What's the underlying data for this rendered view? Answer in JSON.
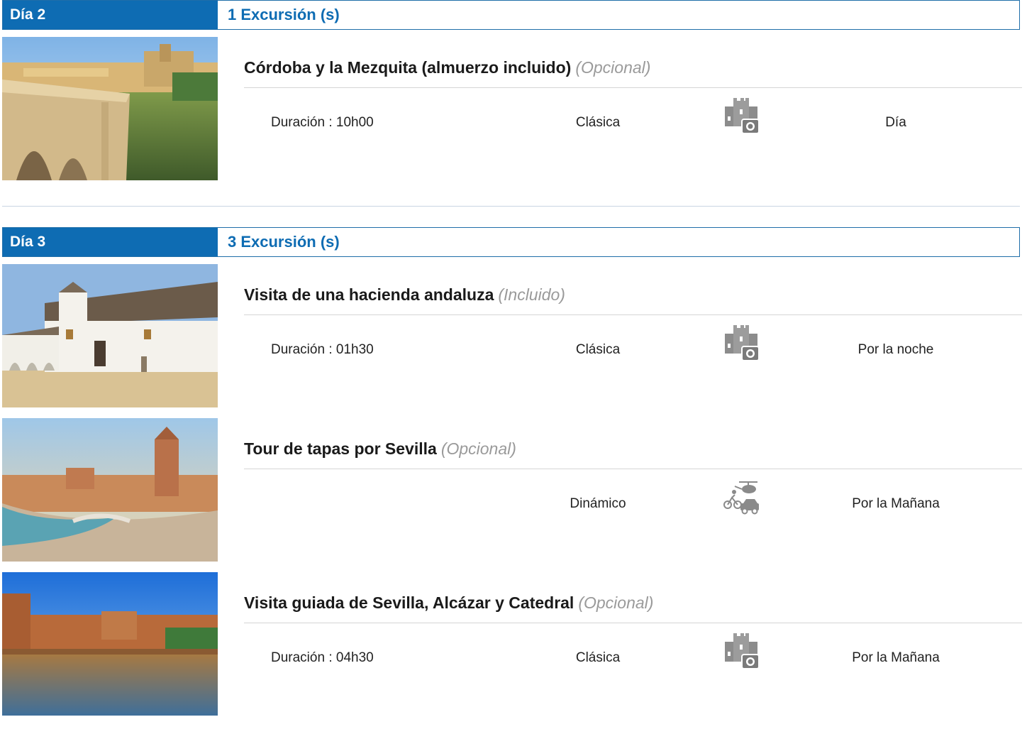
{
  "days": [
    {
      "label": "Día 2",
      "count": "1 Excursión (s)",
      "excursions": [
        {
          "title": "Córdoba y la Mezquita (almuerzo incluido)",
          "status": "(Opcional)",
          "duration": "Duración : 10h00",
          "type": "Clásica",
          "type_icon": "castle-camera-icon",
          "time": "Día"
        }
      ]
    },
    {
      "label": "Día 3",
      "count": "3 Excursión (s)",
      "excursions": [
        {
          "title": "Visita de una hacienda andaluza",
          "status": "(Incluido)",
          "duration": "Duración : 01h30",
          "type": "Clásica",
          "type_icon": "castle-camera-icon",
          "time": "Por la noche"
        },
        {
          "title": "Tour de tapas por Sevilla",
          "status": "(Opcional)",
          "duration": "",
          "type": "Dinámico",
          "type_icon": "helicopter-bike-car-icon",
          "time": "Por la Mañana"
        },
        {
          "title": "Visita guiada de Sevilla, Alcázar y Catedral",
          "status": "(Opcional)",
          "duration": "Duración : 04h30",
          "type": "Clásica",
          "type_icon": "castle-camera-icon",
          "time": "Por la Mañana"
        }
      ]
    }
  ],
  "colors": {
    "primary_blue": "#0e6cb3",
    "status_gray": "#9a9a9a",
    "rule_gray": "#d5d5d5"
  }
}
